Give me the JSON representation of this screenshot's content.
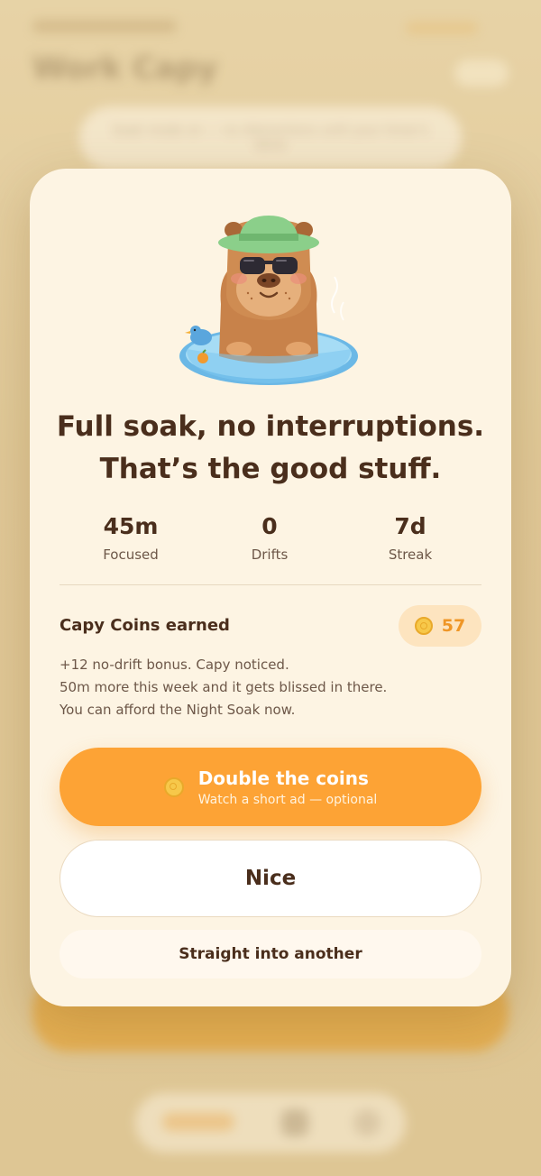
{
  "background": {
    "title": "Work Capy",
    "banner": "Soak mode on — no distractions until your timer's done"
  },
  "modal": {
    "headline_line1": "Full soak, no interruptions.",
    "headline_line2": "That’s the good stuff.",
    "stats": [
      {
        "value": "45m",
        "label": "Focused"
      },
      {
        "value": "0",
        "label": "Drifts"
      },
      {
        "value": "7d",
        "label": "Streak"
      }
    ],
    "coins_label": "Capy Coins earned",
    "coins_value": "57",
    "messages": [
      "+12 no-drift bonus. Capy noticed.",
      "50m more this week and it gets blissed in there.",
      "You can afford the Night Soak now."
    ],
    "primary_button": {
      "label": "Double the coins",
      "sublabel": "Watch a short ad — optional",
      "icon": "coin-icon"
    },
    "secondary_button": "Nice",
    "tertiary_button": "Straight into another"
  },
  "colors": {
    "accent": "#fda335",
    "text": "#4a2e1c",
    "modal_bg": "#fdf4e3",
    "coin": "#ef9626"
  }
}
